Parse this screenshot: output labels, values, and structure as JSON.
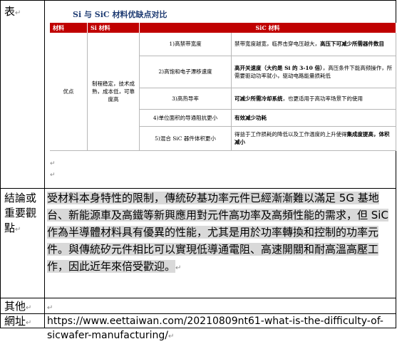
{
  "labels": {
    "table_label": "表",
    "conclusion_label": "結論或重要觀點",
    "other_label": "其他",
    "url_label": "網址"
  },
  "figure": {
    "title": "Si 与 SiC 材料优缺点对比",
    "headers": [
      "材料",
      "Si 材料",
      "SiC 材料"
    ],
    "row_label": "优点",
    "si_column": "制程稳定，技术成熟，成本低，可靠度高",
    "rows": [
      {
        "item": "1)高禁带宽度",
        "desc_a": "禁带宽度越宽，临界击穿电压越大，",
        "desc_b": "高压下可减少所需器件数目"
      },
      {
        "item": "2)高饱和电子漂移速度",
        "desc_a": "高开关速度（大约是 Si 的 3-10 倍）",
        "desc_b": "，高压条件下能高频操作，所需要驱动功率就小，驱动电路能量损耗低"
      },
      {
        "item": "3)高热导率",
        "desc_a": "可减少所需冷却系统",
        "desc_b": "，也更适用于高功率场景下的使用"
      },
      {
        "item": "4)单位面积的导通阻抗更小",
        "desc_a": "有效减少功耗",
        "desc_b": ""
      },
      {
        "item": "5)混合 SiC 器件体积更小",
        "desc_a": "得益于工作损耗的降低以及工作温度的上升使得",
        "desc_b": "集成度提高，体积减小"
      }
    ]
  },
  "conclusion": "受材料本身特性的限制，傳統矽基功率元件已經漸漸難以滿足 5G 基地台、新能源車及高鐵等新興應用對元件高功率及高頻性能的需求，但 SiC 作為半導體材料具有優異的性能，尤其是用於功率轉換和控制的功率元件。與傳統矽元件相比可以實現低導通電阻、高速開關和耐高溫高壓工作，因此近年來倍受歡迎。",
  "other": "",
  "url": "https://www.eettaiwan.com/20210809nt61-what-is-the-difficulty-of-sicwafer-manufacturing/"
}
